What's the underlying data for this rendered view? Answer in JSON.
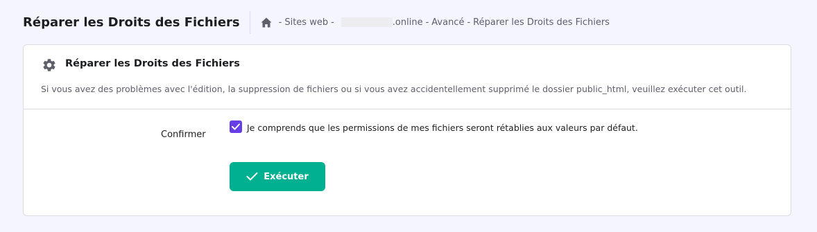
{
  "header": {
    "title": "Réparer les Droits des Fichiers",
    "breadcrumb": {
      "sep": "-",
      "items": [
        "Sites web",
        ".online",
        "Avancé",
        "Réparer les Droits des Fichiers"
      ]
    }
  },
  "card": {
    "title": "Réparer les Droits des Fichiers",
    "description": "Si vous avez des problèmes avec l'édition, la suppression de fichiers ou si vous avez accidentellement supprimé le dossier public_html, veuillez exécuter cet outil.",
    "confirm_label": "Confirmer",
    "checkbox_text": "Je comprends que les permissions de mes fichiers seront rétablies aux valeurs par défaut.",
    "checkbox_checked": true,
    "button_label": "Exécuter"
  },
  "colors": {
    "accent_purple": "#673de6",
    "button_green": "#00b090",
    "background": "#f4f5ff",
    "icon_gray": "#5f5f6b"
  },
  "icons": [
    "home-icon",
    "gear-icon",
    "checkbox-check-icon",
    "check-icon"
  ]
}
